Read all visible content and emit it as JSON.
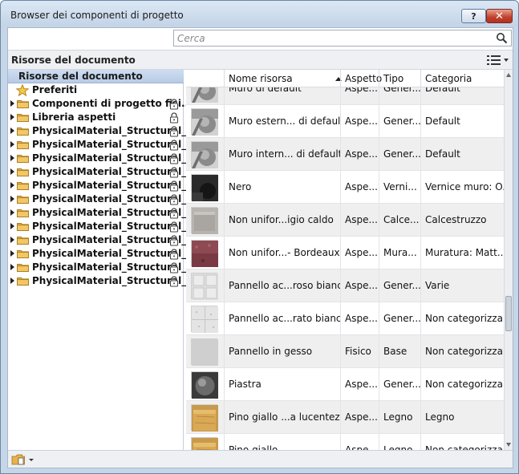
{
  "window": {
    "title": "Browser dei componenti di progetto",
    "help_label": "?",
    "close_label": "✕"
  },
  "search": {
    "placeholder": "Cerca"
  },
  "section": {
    "title": "Risorse del documento"
  },
  "tree": {
    "header": "Risorse del documento",
    "items": [
      {
        "label": "Preferiti",
        "icon": "star-icon",
        "locked": false
      },
      {
        "label": "Componenti di progetto fisi...",
        "icon": "folder-icon",
        "locked": true
      },
      {
        "label": "Libreria aspetti",
        "icon": "folder-icon",
        "locked": true
      },
      {
        "label": "PhysicalMaterial_Structural_...",
        "icon": "folder-icon",
        "locked": true
      },
      {
        "label": "PhysicalMaterial_Structural_...",
        "icon": "folder-icon",
        "locked": true
      },
      {
        "label": "PhysicalMaterial_Structural_...",
        "icon": "folder-icon",
        "locked": true
      },
      {
        "label": "PhysicalMaterial_Structural_...",
        "icon": "folder-icon",
        "locked": true
      },
      {
        "label": "PhysicalMaterial_Structural_...",
        "icon": "folder-icon",
        "locked": true
      },
      {
        "label": "PhysicalMaterial_Structural_...",
        "icon": "folder-icon",
        "locked": true
      },
      {
        "label": "PhysicalMaterial_Structural_...",
        "icon": "folder-icon",
        "locked": true
      },
      {
        "label": "PhysicalMaterial_Structural_...",
        "icon": "folder-icon",
        "locked": true
      },
      {
        "label": "PhysicalMaterial_Structural_...",
        "icon": "folder-icon",
        "locked": true
      },
      {
        "label": "PhysicalMaterial_Structural_...",
        "icon": "folder-icon",
        "locked": true
      },
      {
        "label": "PhysicalMaterial_Structural_...",
        "icon": "folder-icon",
        "locked": true
      },
      {
        "label": "PhysicalMaterial_Structural_...",
        "icon": "folder-icon",
        "locked": true
      }
    ]
  },
  "grid": {
    "columns": [
      "Nome risorsa",
      "Aspetto",
      "Tipo",
      "Categoria"
    ],
    "rows": [
      {
        "name": "Muro di default",
        "aspetto": "Aspe...",
        "tipo": "Gener...",
        "categoria": "Default",
        "thumb": "wall-sphere-gray"
      },
      {
        "name": "Muro estern... di default",
        "aspetto": "Aspe...",
        "tipo": "Gener...",
        "categoria": "Default",
        "thumb": "wall-sphere-gray"
      },
      {
        "name": "Muro intern... di default",
        "aspetto": "Aspe...",
        "tipo": "Gener...",
        "categoria": "Default",
        "thumb": "wall-sphere-gray"
      },
      {
        "name": "Nero",
        "aspetto": "Aspe...",
        "tipo": "Verni...",
        "categoria": "Vernice muro: O...",
        "thumb": "black"
      },
      {
        "name": "Non unifor...igio caldo",
        "aspetto": "Aspe...",
        "tipo": "Calce...",
        "categoria": "Calcestruzzo",
        "thumb": "concrete-gray"
      },
      {
        "name": "Non unifor...- Bordeaux",
        "aspetto": "Aspe...",
        "tipo": "Mura...",
        "categoria": "Muratura: Matt...",
        "thumb": "brick-bordeaux"
      },
      {
        "name": "Pannello ac...roso bianco",
        "aspetto": "Aspe...",
        "tipo": "Gener...",
        "categoria": "Varie",
        "thumb": "tile-white"
      },
      {
        "name": "Pannello ac...rato bianco",
        "aspetto": "Aspe...",
        "tipo": "Gener...",
        "categoria": "Non categorizza...",
        "thumb": "tile-speckled"
      },
      {
        "name": "Pannello in gesso",
        "aspetto": "Fisico",
        "tipo": "Base",
        "categoria": "Non categorizza...",
        "thumb": "plain-gray"
      },
      {
        "name": "Piastra",
        "aspetto": "Aspe...",
        "tipo": "Gener...",
        "categoria": "Non categorizza...",
        "thumb": "sphere-dark"
      },
      {
        "name": "Pino giallo ...a lucentezza",
        "aspetto": "Aspe...",
        "tipo": "Legno",
        "categoria": "Legno",
        "thumb": "wood-pine"
      },
      {
        "name": "Pino giallo ...",
        "aspetto": "Aspe...",
        "tipo": "Legno",
        "categoria": "Non categorizza...",
        "thumb": "wood-pine"
      }
    ]
  },
  "colors": {
    "title_bg": "#c5d6e8",
    "close_red": "#c2402b",
    "tree_header": "#b7cbe6",
    "folder": "#e6b34a"
  }
}
